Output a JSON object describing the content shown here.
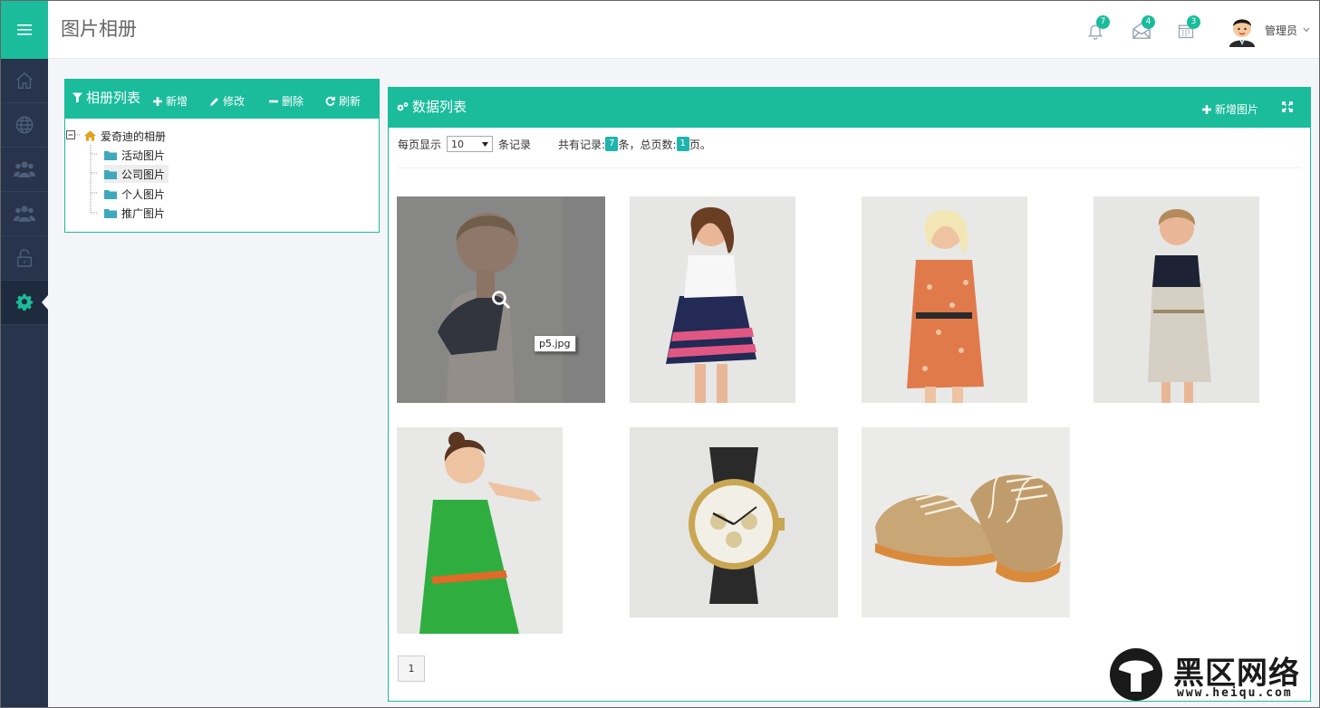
{
  "header": {
    "title": "图片相册",
    "notifications_count": "7",
    "messages_count": "4",
    "tasks_count": "3",
    "user_name": "管理员"
  },
  "sidebar": {
    "items": [
      {
        "icon": "home-icon"
      },
      {
        "icon": "globe-icon"
      },
      {
        "icon": "users-icon"
      },
      {
        "icon": "group-icon"
      },
      {
        "icon": "unlock-icon"
      },
      {
        "icon": "gear-icon",
        "active": true
      }
    ]
  },
  "album_panel": {
    "title": "相册列表",
    "add_label": "新增",
    "edit_label": "修改",
    "delete_label": "删除",
    "refresh_label": "刷新",
    "tree": {
      "root": "爱奇迪的相册",
      "children": [
        "活动图片",
        "公司图片",
        "个人图片",
        "推广图片"
      ],
      "selected": "公司图片"
    }
  },
  "data_panel": {
    "title": "数据列表",
    "add_image_label": "新增图片",
    "per_page_prefix": "每页显示",
    "per_page_value": "10",
    "per_page_suffix": "条记录",
    "total_prefix": "共有记录:",
    "total_records": "7",
    "total_mid": "条，总页数:",
    "total_pages": "1",
    "total_suffix": "页。",
    "hover_tooltip": "p5.jpg",
    "images": [
      {
        "name": "woman-black-white-dress"
      },
      {
        "name": "woman-striped-skirt"
      },
      {
        "name": "woman-floral-dress"
      },
      {
        "name": "woman-grey-dress"
      },
      {
        "name": "woman-green-dress"
      },
      {
        "name": "wrist-watch"
      },
      {
        "name": "canvas-sneakers"
      }
    ],
    "pagination": [
      "1"
    ]
  },
  "watermark": {
    "text": "黑区网络",
    "url": "www.heiqu.com"
  },
  "colors": {
    "accent": "#1abc9c",
    "sidebar_bg": "#27344c",
    "badge": "#1fb5ac"
  }
}
